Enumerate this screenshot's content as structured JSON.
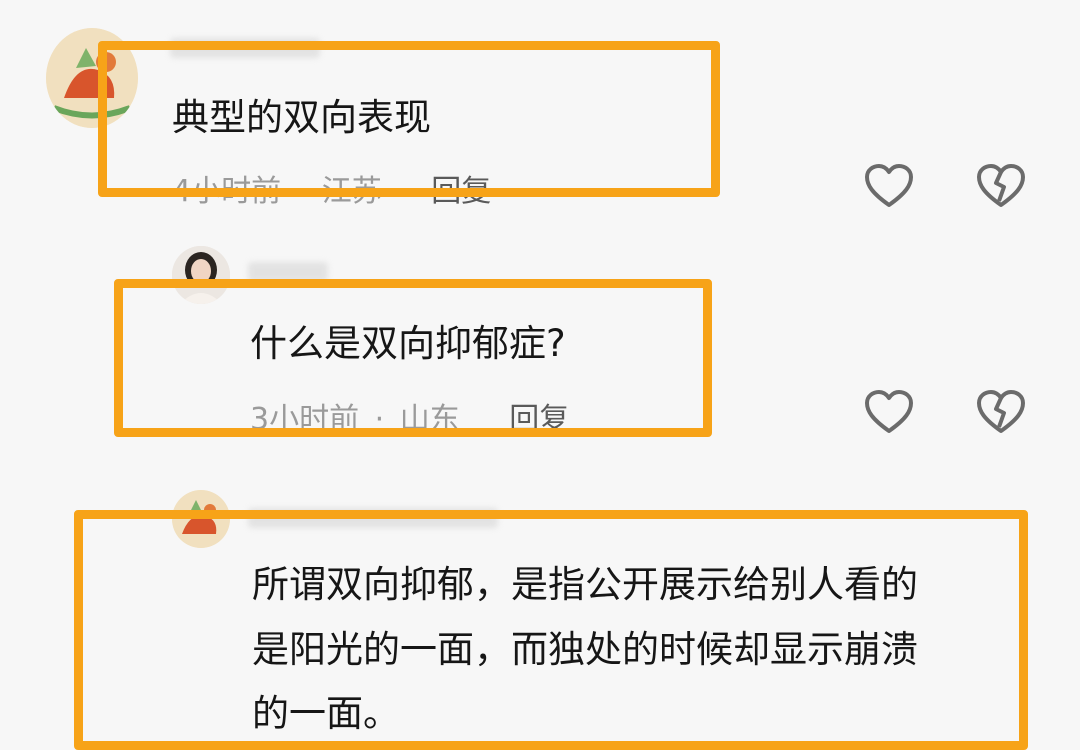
{
  "comments": [
    {
      "text": "典型的双向表现",
      "time": "4小时前",
      "sep": "·",
      "location": "江苏",
      "reply": "回复"
    },
    {
      "text": "什么是双向抑郁症?",
      "time": "3小时前",
      "sep": "·",
      "location": "山东",
      "reply": "回复"
    },
    {
      "lines": [
        "所谓双向抑郁，是指公开展示给别人看的",
        "是阳光的一面，而独处的时候却显示崩溃",
        "的一面。"
      ]
    }
  ],
  "highlight_color": "#f7a318",
  "icons": [
    "heart-icon",
    "broken-heart-icon"
  ]
}
